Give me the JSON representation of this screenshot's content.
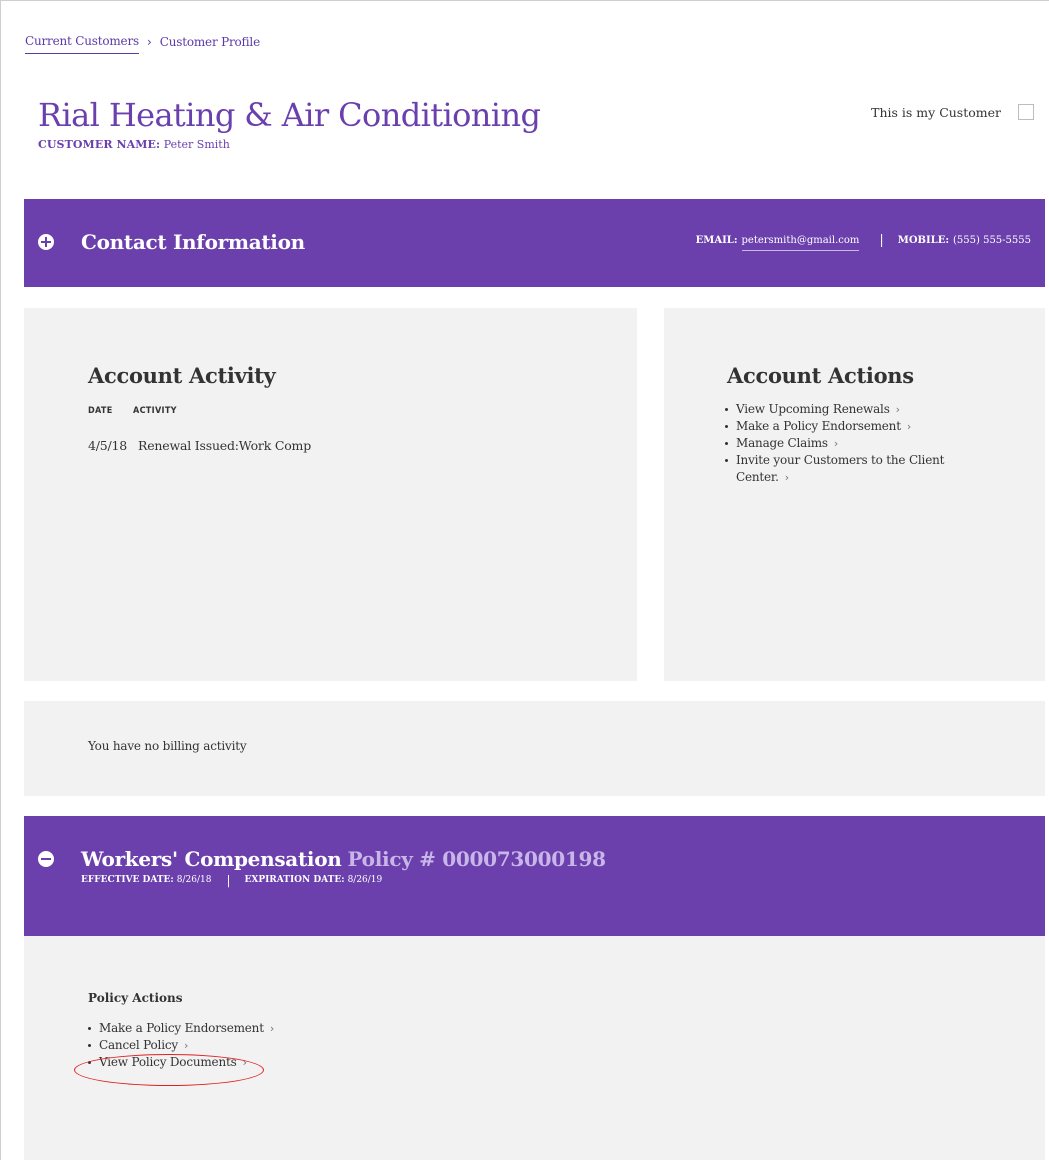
{
  "breadcrumb": {
    "link": "Current Customers",
    "separator": "›",
    "current": "Customer Profile"
  },
  "header": {
    "title": "Rial Heating & Air Conditioning",
    "customer_label": "CUSTOMER NAME:",
    "customer_name": "Peter Smith",
    "my_customer_label": "This is my Customer",
    "my_customer_checked": false
  },
  "contact": {
    "title": "Contact Information",
    "email_label": "EMAIL:",
    "email": "petersmith@gmail.com",
    "pipe": "|",
    "mobile_label": "MOBILE:",
    "mobile": "(555) 555-5555"
  },
  "activity": {
    "title": "Account Activity",
    "headers": {
      "date": "DATE",
      "activity": "ACTIVITY"
    },
    "rows": [
      {
        "date": "4/5/18",
        "activity": "Renewal Issued:Work Comp"
      }
    ]
  },
  "account_actions": {
    "title": "Account Actions",
    "items": [
      {
        "label": "View Upcoming Renewals"
      },
      {
        "label": "Make a Policy Endorsement"
      },
      {
        "label": "Manage Claims"
      },
      {
        "label": "Invite your Customers to the Client Center."
      }
    ]
  },
  "billing": {
    "message": "You have no billing activity"
  },
  "policy": {
    "name": "Workers' Compensation",
    "number": "Policy # 000073000198",
    "effective_label": "EFFECTIVE DATE:",
    "effective": "8/26/18",
    "pipe": "|",
    "expiration_label": "EXPIRATION DATE:",
    "expiration": "8/26/19",
    "actions_title": "Policy Actions",
    "actions": [
      {
        "label": "Make a Policy Endorsement"
      },
      {
        "label": "Cancel Policy"
      },
      {
        "label": "View Policy Documents"
      }
    ]
  },
  "chevron": "›",
  "colors": {
    "brand_purple": "#6b40ad",
    "panel_gray": "#f2f2f2",
    "highlight_red": "#e02020"
  }
}
